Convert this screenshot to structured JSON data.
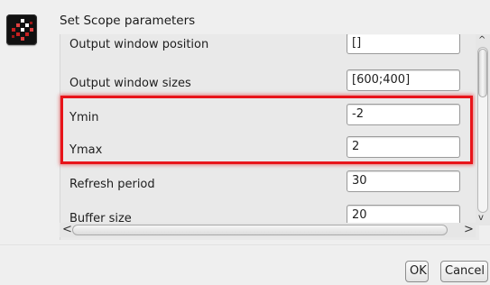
{
  "dialog": {
    "title": "Set Scope parameters",
    "app_icon": "scilab-logo-icon"
  },
  "parameters": [
    {
      "label": "Output window position",
      "value": "[]"
    },
    {
      "label": "Output window sizes",
      "value": "[600;400]"
    },
    {
      "label": "Ymin",
      "value": "-2"
    },
    {
      "label": "Ymax",
      "value": "2"
    },
    {
      "label": "Refresh period",
      "value": "30"
    },
    {
      "label": "Buffer size",
      "value": "20"
    }
  ],
  "highlight": {
    "color": "#e8141a",
    "target_labels": [
      "Ymin",
      "Ymax"
    ]
  },
  "scrollbars": {
    "vertical": {
      "up_glyph": "^",
      "down_glyph": "v",
      "up_icon": "chevron-up-icon",
      "down_icon": "chevron-down-icon"
    },
    "horizontal": {
      "left_glyph": "<",
      "right_glyph": ">",
      "left_icon": "chevron-left-icon",
      "right_icon": "chevron-right-icon"
    }
  },
  "buttons": {
    "ok_label": "OK",
    "cancel_label": "Cancel"
  }
}
